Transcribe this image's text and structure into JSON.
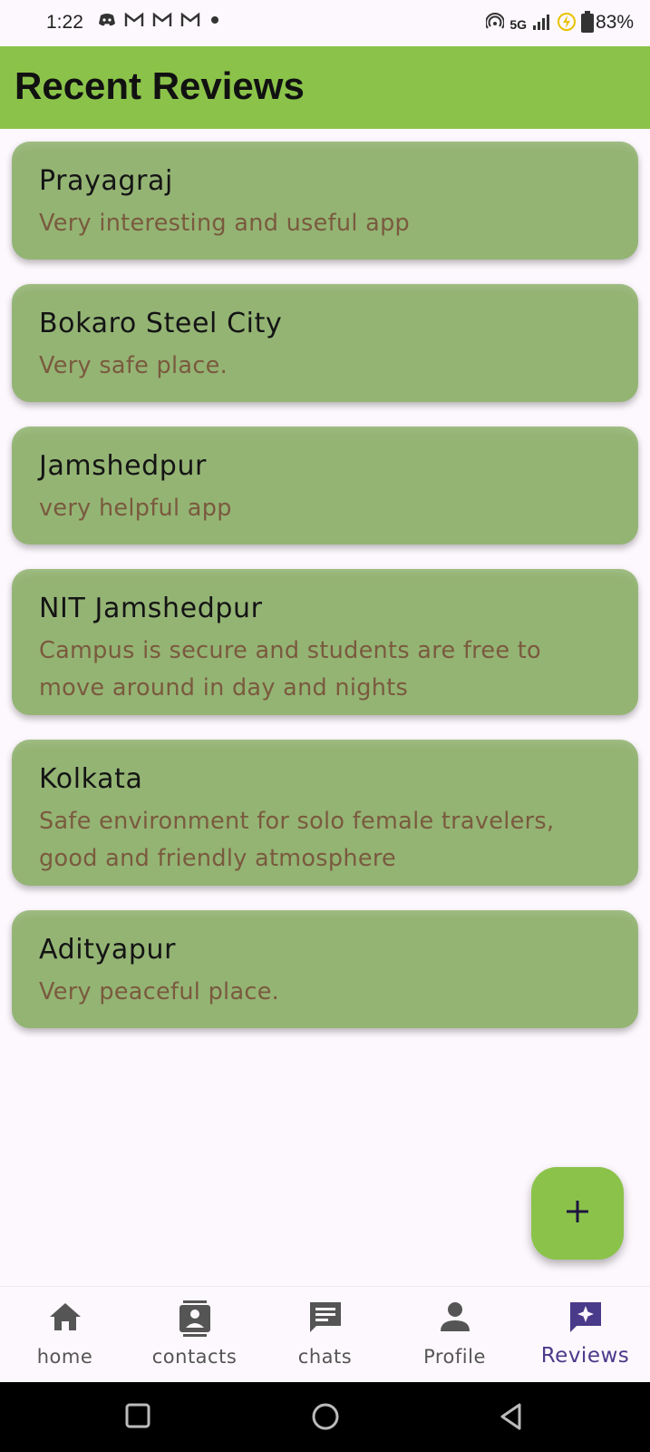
{
  "status_bar": {
    "time": "1:22",
    "network": "5G",
    "battery": "83%",
    "icons": [
      "discord-icon",
      "gmail-icon",
      "gmail-icon",
      "gmail-icon",
      "dot-icon",
      "hotspot-icon",
      "signal-icon",
      "charging-icon",
      "battery-icon"
    ]
  },
  "app_bar": {
    "title": "Recent Reviews"
  },
  "reviews": [
    {
      "place": "Prayagraj",
      "comment": "Very interesting and useful app"
    },
    {
      "place": "Bokaro Steel City",
      "comment": "Very safe place."
    },
    {
      "place": "Jamshedpur",
      "comment": "very helpful app"
    },
    {
      "place": "NIT Jamshedpur",
      "comment": "Campus is secure and students are free to move around in day and nights"
    },
    {
      "place": "Kolkata",
      "comment": "Safe environment for solo female travelers, good and friendly atmosphere"
    },
    {
      "place": "Adityapur",
      "comment": "Very peaceful place."
    }
  ],
  "fab": {
    "icon": "plus-icon"
  },
  "bottom_nav": {
    "items": [
      {
        "label": "home",
        "icon": "home-icon"
      },
      {
        "label": "contacts",
        "icon": "contacts-icon"
      },
      {
        "label": "chats",
        "icon": "chat-icon"
      },
      {
        "label": "Profile",
        "icon": "person-icon"
      },
      {
        "label": "Reviews",
        "icon": "reviews-icon",
        "active": true
      }
    ]
  },
  "colors": {
    "accent": "#8bc34a",
    "card": "#94b474",
    "active_nav": "#4a3a8a"
  }
}
